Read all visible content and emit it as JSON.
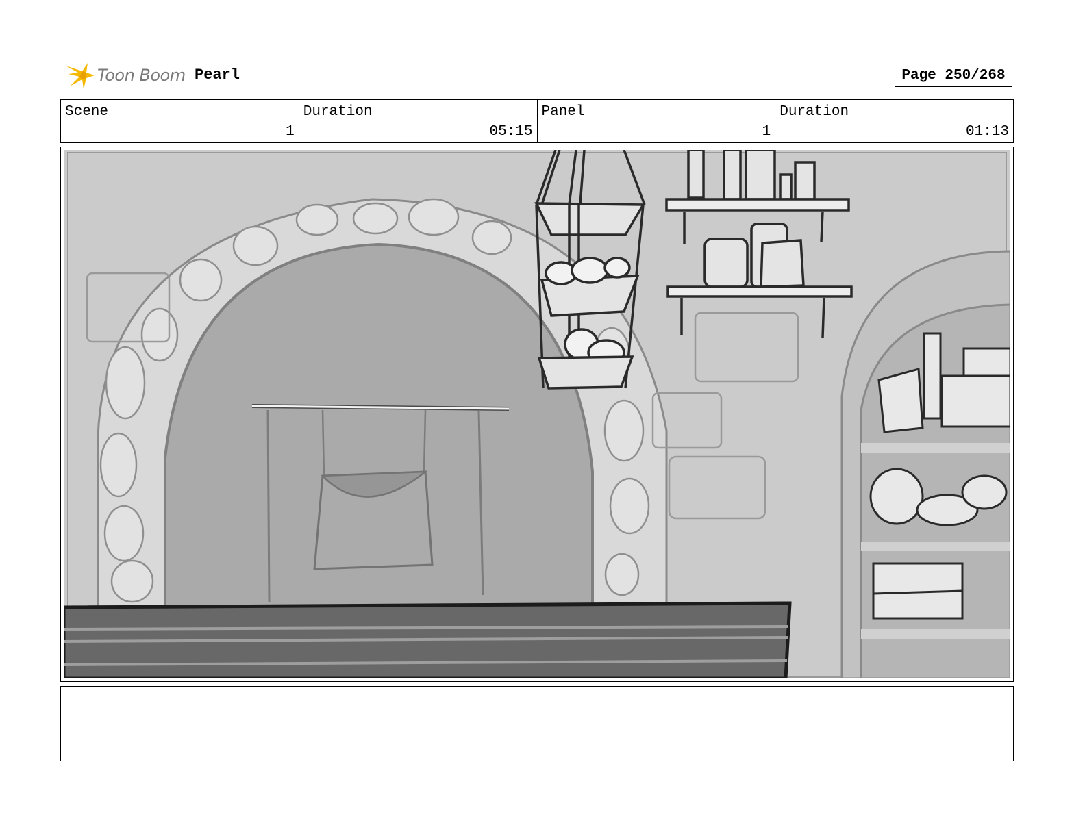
{
  "header": {
    "brand": "Toon Boom",
    "project_title": "Pearl",
    "page_label": "Page 250/268"
  },
  "info": {
    "scene_label": "Scene",
    "scene_value": "1",
    "scene_duration_label": "Duration",
    "scene_duration_value": "05:15",
    "panel_label": "Panel",
    "panel_value": "1",
    "panel_duration_label": "Duration",
    "panel_duration_value": "01:13"
  },
  "panel": {
    "description": ""
  },
  "notes": {
    "text": ""
  }
}
